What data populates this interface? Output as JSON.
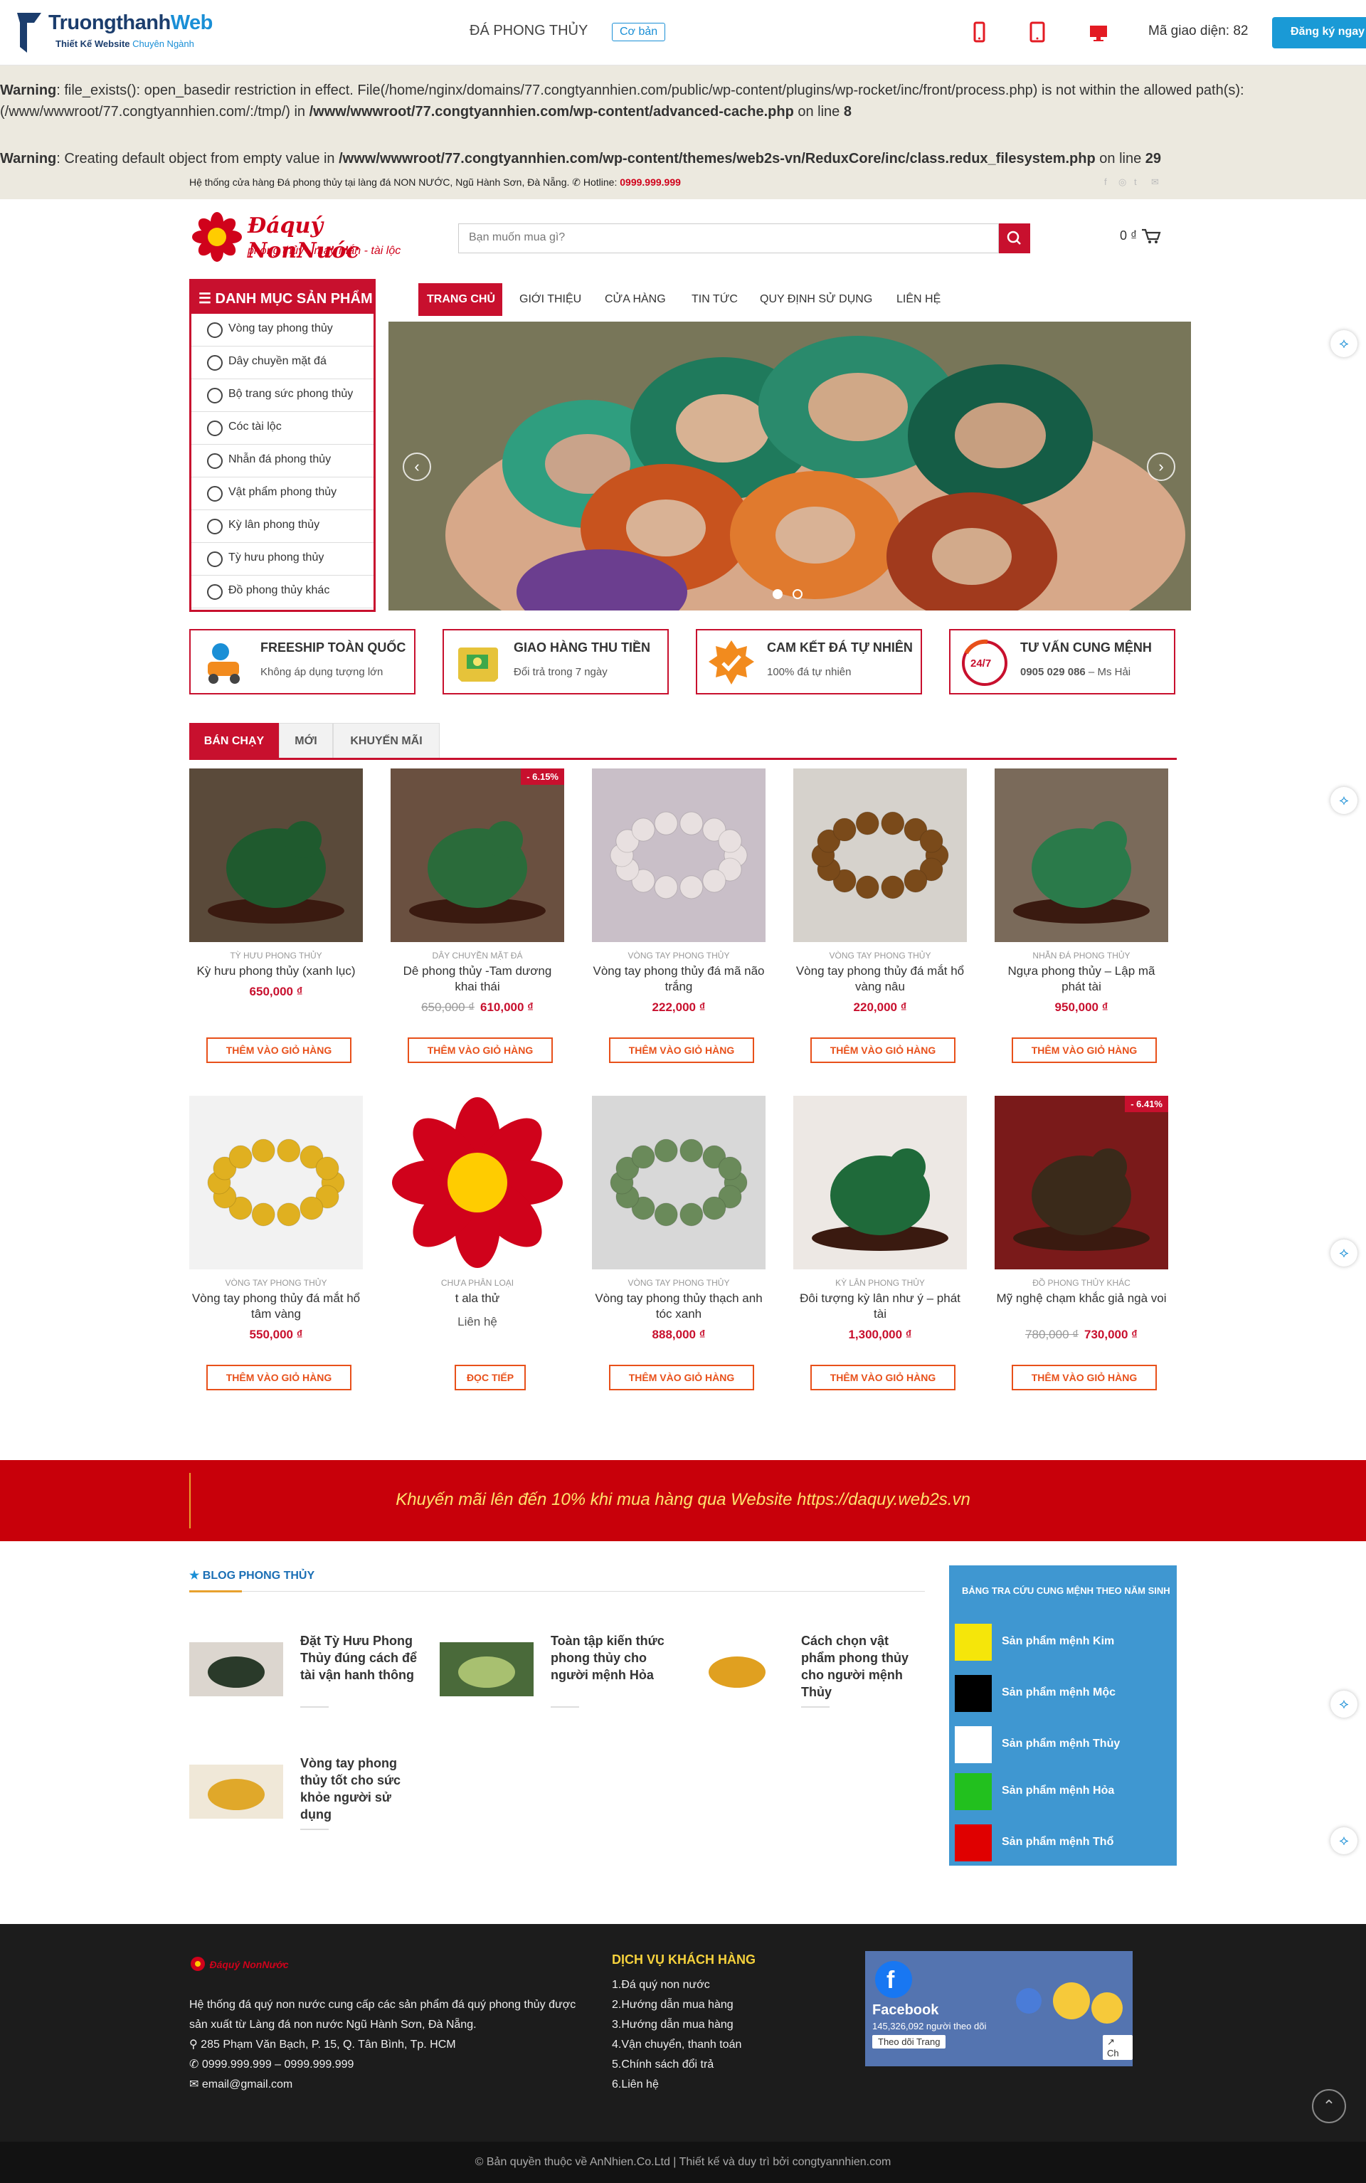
{
  "topbar": {
    "logo_main": "Truongthanh",
    "logo_accent": "Web",
    "logo_sub": "Thiết Kế Website",
    "logo_sub_accent": "Chuyên Ngành",
    "theme_name": "ĐÁ PHONG THỦY",
    "theme_plan": "Cơ bản",
    "interface_code": "Mã giao diện: 82",
    "register_label": "Đăng ký ngay",
    "device_icons": [
      "mobile-icon",
      "tablet-icon",
      "desktop-icon"
    ]
  },
  "warnings": {
    "w1_label": "Warning",
    "w1_text": ": file_exists(): open_basedir restriction in effect. File(/home/nginx/domains/77.congtyannhien.com/public/wp-content/plugins/wp-rocket/inc/front/process.php) is not within the allowed path(s): (/www/wwwroot/77.congtyannhien.com/:/tmp/) in ",
    "w1_path": "/www/wwwroot/77.congtyannhien.com/wp-content/advanced-cache.php",
    "w1_line": " on line ",
    "w1_num": "8",
    "w2_label": "Warning",
    "w2_text": ": Creating default object from empty value in ",
    "w2_path": "/www/wwwroot/77.congtyannhien.com/wp-content/themes/web2s-vn/ReduxCore/inc/class.redux_filesystem.php",
    "w2_line": " on line ",
    "w2_num": "29"
  },
  "infobar": {
    "text": "Hệ thống cửa hàng Đá phong thủy tại làng đá NON NƯỚC, Ngũ Hành Sơn, Đà Nẵng.",
    "hotline_label": "Hotline:",
    "hotline": "0999.999.999"
  },
  "header": {
    "logo_title": "Đáquý NonNước",
    "logo_tagline": "phong thủy - may mắn - tài lộc",
    "search_placeholder": "Bạn muốn mua gì?",
    "cart_total": "0 ₫"
  },
  "category_menu": {
    "title": "DANH MỤC SẢN PHẨM",
    "items": [
      "Vòng tay phong thủy",
      "Dây chuyền mặt đá",
      "Bộ trang sức phong thủy",
      "Cóc tài lộc",
      "Nhẫn đá phong thủy",
      "Vật phẩm phong thủy",
      "Kỳ lân phong thủy",
      "Tỳ hưu phong thủy",
      "Đồ phong thủy khác"
    ]
  },
  "nav": {
    "items": [
      "TRANG CHỦ",
      "GIỚI THIỆU",
      "CỬA HÀNG",
      "TIN TỨC",
      "QUY ĐỊNH SỬ DỤNG",
      "LIÊN HỆ"
    ]
  },
  "slider": {
    "prev": "‹",
    "next": "›"
  },
  "features": [
    {
      "title": "FREESHIP TOÀN QUỐC",
      "sub": "Không áp dụng tượng lớn"
    },
    {
      "title": "GIAO HÀNG THU TIỀN",
      "sub": "Đổi trả trong 7 ngày"
    },
    {
      "title": "CAM KẾT ĐÁ TỰ NHIÊN",
      "sub": "100% đá tự nhiên"
    },
    {
      "title": "TƯ VẤN CUNG MỆNH",
      "sub": "0905 029 086",
      "sub2": " – Ms Hải",
      "badge": "24/7"
    }
  ],
  "tabs": [
    "BÁN CHẠY",
    "MỚI",
    "KHUYẾN MÃI"
  ],
  "products": [
    {
      "cat": "TỲ HƯU PHONG THỦY",
      "name": "Kỳ hưu phong thủy (xanh lục)",
      "price": "650,000 ₫",
      "old": "",
      "sale": "",
      "btn": "THÊM VÀO GIỎ HÀNG"
    },
    {
      "cat": "DÂY CHUYỀN MẶT ĐÁ",
      "name": "Dê phong thủy -Tam dương khai thái",
      "price": "610,000 ₫",
      "old": "650,000 ₫",
      "sale": "- 6.15%",
      "btn": "THÊM VÀO GIỎ HÀNG"
    },
    {
      "cat": "VÒNG TAY PHONG THỦY",
      "name": "Vòng tay phong thủy đá mã não trắng",
      "price": "222,000 ₫",
      "old": "",
      "sale": "",
      "btn": "THÊM VÀO GIỎ HÀNG"
    },
    {
      "cat": "VÒNG TAY PHONG THỦY",
      "name": "Vòng tay phong thủy đá mắt hổ vàng nâu",
      "price": "220,000 ₫",
      "old": "",
      "sale": "",
      "btn": "THÊM VÀO GIỎ HÀNG"
    },
    {
      "cat": "NHẪN ĐÁ PHONG THỦY",
      "name": "Ngựa phong thủy – Lập mã phát tài",
      "price": "950,000 ₫",
      "old": "",
      "sale": "",
      "btn": "THÊM VÀO GIỎ HÀNG"
    },
    {
      "cat": "VÒNG TAY PHONG THỦY",
      "name": "Vòng tay phong thủy đá mắt hổ tâm vàng",
      "price": "550,000 ₫",
      "old": "",
      "sale": "",
      "btn": "THÊM VÀO GIỎ HÀNG"
    },
    {
      "cat": "CHƯA PHÂN LOẠI",
      "name": "t ala thử",
      "price": "Liên hệ",
      "old": "",
      "sale": "",
      "btn": "ĐỌC TIẾP"
    },
    {
      "cat": "VÒNG TAY PHONG THỦY",
      "name": "Vòng tay phong thủy thạch anh tóc xanh",
      "price": "888,000 ₫",
      "old": "",
      "sale": "",
      "btn": "THÊM VÀO GIỎ HÀNG"
    },
    {
      "cat": "KỲ LÂN PHONG THỦY",
      "name": "Đôi tượng kỳ lân như ý – phát tài",
      "price": "1,300,000 ₫",
      "old": "",
      "sale": "",
      "btn": "THÊM VÀO GIỎ HÀNG"
    },
    {
      "cat": "ĐỒ PHONG THỦY KHÁC",
      "name": "Mỹ nghệ chạm khắc giả ngà voi",
      "price": "730,000 ₫",
      "old": "780,000 ₫",
      "sale": "- 6.41%",
      "btn": "THÊM VÀO GIỎ HÀNG"
    }
  ],
  "promo": {
    "text": "Khuyến mãi lên đến 10% khi mua hàng qua Website https://daquy.web2s.vn"
  },
  "blog": {
    "title": "BLOG PHONG THỦY",
    "posts": [
      "Đặt Tỳ Hưu Phong Thủy đúng cách để tài vận hanh thông",
      "Toàn tập kiến thức phong thủy cho người mệnh Hỏa",
      "Cách chọn vật phẩm phong thủy cho người mệnh Thủy",
      "Vòng tay phong thủy tốt cho sức khỏe người sử dụng"
    ]
  },
  "menh": {
    "title": "BẢNG TRA CỨU CUNG MỆNH THEO NĂM SINH",
    "rows": [
      {
        "label": "Sản phẩm mệnh Kim",
        "color": "#f5e60a"
      },
      {
        "label": "Sản phẩm mệnh Mộc",
        "color": "#000000"
      },
      {
        "label": "Sản phẩm mệnh Thủy",
        "color": "#ffffff"
      },
      {
        "label": "Sản phẩm mệnh Hỏa",
        "color": "#22c01e"
      },
      {
        "label": "Sản phẩm mệnh Thổ",
        "color": "#e00000"
      }
    ]
  },
  "footer": {
    "logo_text": "Đáquý NonNước",
    "about": "Hệ thống đá quý non nước cung cấp các sản phẩm đá quý phong thủy được sản xuất từ Làng đá non nước Ngũ Hành Sơn, Đà Nẵng.",
    "address": "285 Phạm Văn Bạch, P. 15, Q. Tân Bình, Tp. HCM",
    "phone": "0999.999.999 – 0999.999.999",
    "email": "email@gmail.com",
    "service_title": "DỊCH VỤ KHÁCH HÀNG",
    "service": [
      "1.Đá quý non nước",
      "2.Hướng dẫn mua hàng",
      "3.Hướng dẫn mua hàng",
      "4.Vận chuyển, thanh toán",
      "5.Chính sách đổi trả",
      "6.Liên hệ"
    ],
    "fb_name": "Facebook",
    "fb_followers": "145,326,092 người theo dõi",
    "fb_follow": "Theo dõi Trang",
    "fb_share": "Ch",
    "copyright": "© Bản quyền thuộc về AnNhien.Co.Ltd  | Thiết kế và duy trì bởi congtyannhien.com"
  },
  "colors": {
    "primary": "#c8102e",
    "accent": "#e8501a",
    "blue": "#1a8fd6"
  }
}
